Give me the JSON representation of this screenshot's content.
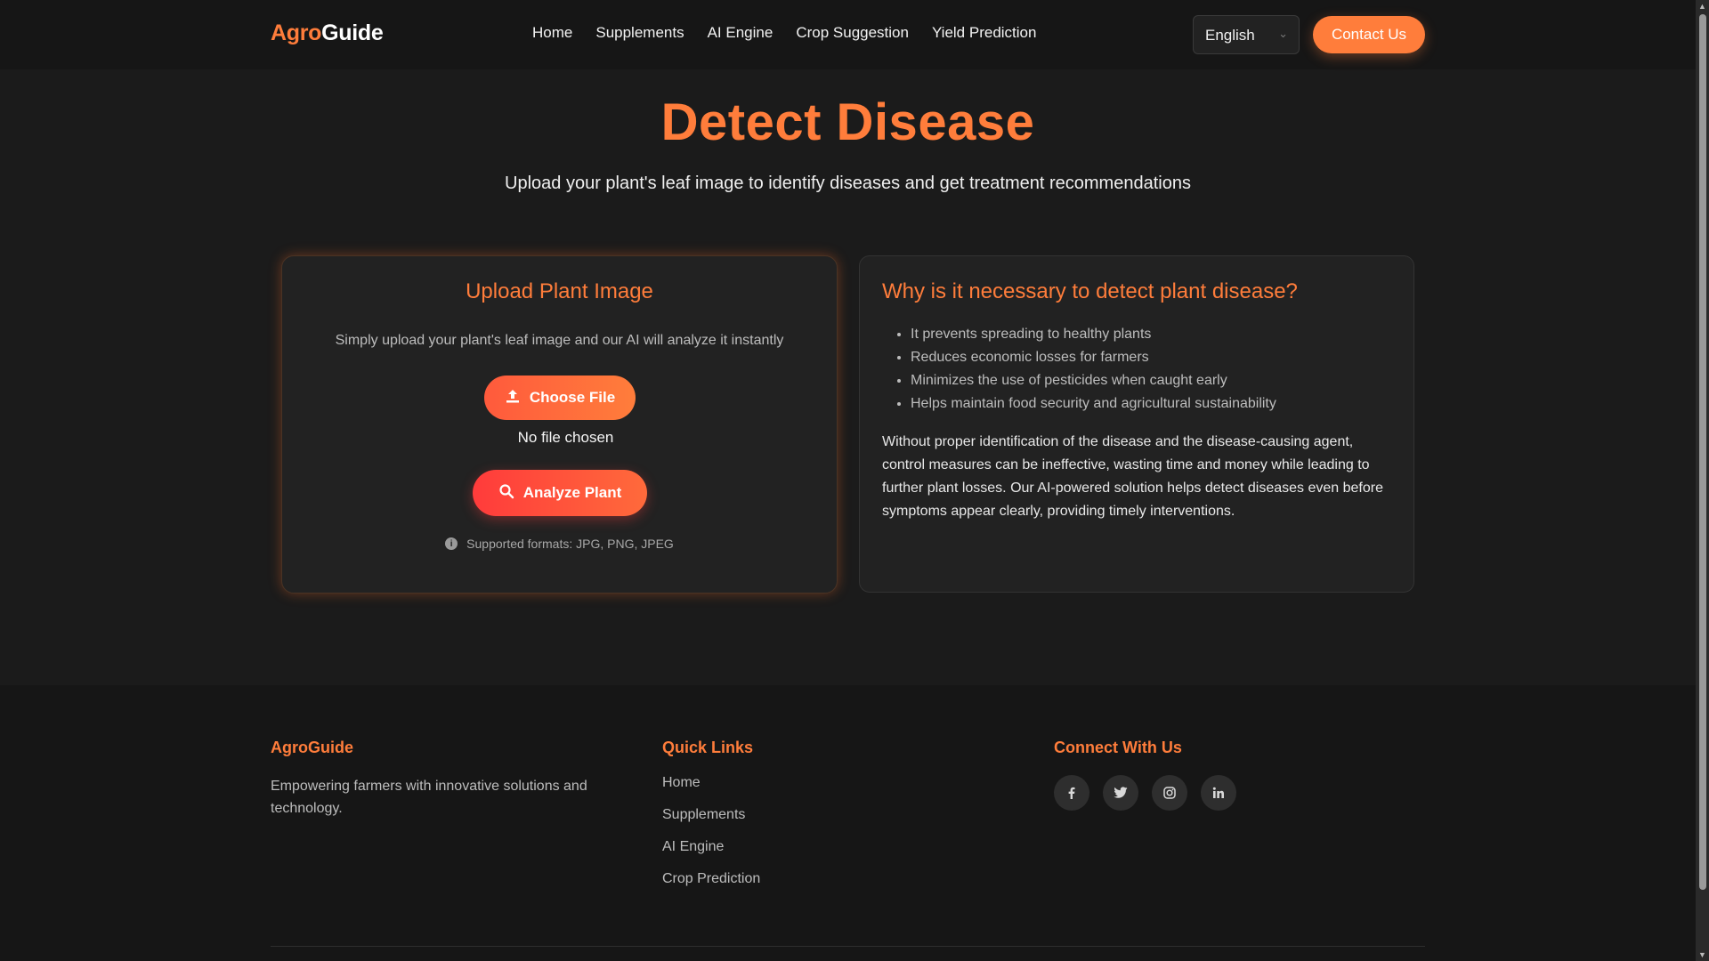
{
  "nav": {
    "logo_part1": "Agro",
    "logo_part2": "Guide",
    "links": [
      "Home",
      "Supplements",
      "AI Engine",
      "Crop Suggestion",
      "Yield Prediction"
    ],
    "language": "English",
    "contact": "Contact Us"
  },
  "hero": {
    "title": "Detect Disease",
    "subtitle": "Upload your plant's leaf image to identify diseases and get treatment recommendations"
  },
  "upload": {
    "title": "Upload Plant Image",
    "description": "Simply upload your plant's leaf image and our AI will analyze it instantly",
    "choose_label": "Choose File",
    "file_status": "No file chosen",
    "analyze_label": "Analyze Plant",
    "formats": "Supported formats: JPG, PNG, JPEG"
  },
  "why": {
    "title": "Why is it necessary to detect plant disease?",
    "bullets": [
      "It prevents spreading to healthy plants",
      "Reduces economic losses for farmers",
      "Minimizes the use of pesticides when caught early",
      "Helps maintain food security and agricultural sustainability"
    ],
    "paragraph": "Without proper identification of the disease and the disease-causing agent, control measures can be ineffective, wasting time and money while leading to further plant losses. Our AI-powered solution helps detect diseases even before symptoms appear clearly, providing timely interventions."
  },
  "footer": {
    "brand": "AgroGuide",
    "tagline": "Empowering farmers with innovative solutions and technology.",
    "quick_links_title": "Quick Links",
    "quick_links": [
      "Home",
      "Supplements",
      "AI Engine",
      "Crop Prediction"
    ],
    "connect_title": "Connect With Us",
    "socials": [
      "facebook-icon",
      "twitter-icon",
      "instagram-icon",
      "linkedin-icon"
    ]
  },
  "colors": {
    "accent": "#ff7d3b",
    "background": "#1b1b1b",
    "card": "#222222"
  }
}
